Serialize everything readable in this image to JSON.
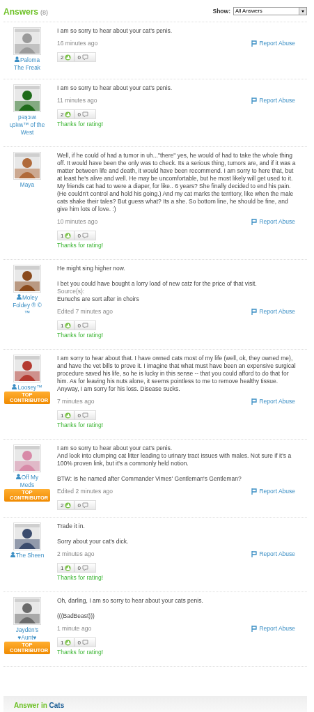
{
  "header": {
    "title": "Answers",
    "count": "(8)",
    "filter_label": "Show:",
    "filter_value": "All Answers"
  },
  "answers": [
    {
      "author": {
        "name": "Paloma The Freak",
        "user_icon": true
      },
      "avatar": {
        "kind": "picture"
      },
      "paragraphs": [
        "I am so sorry to hear about your cat's penis."
      ],
      "time": "16 minutes ago",
      "report": "Report Abuse",
      "up": "2",
      "down": "0"
    },
    {
      "author": {
        "name": "pǝʞɔıʍ ɥɔʇıʍ™ of the West",
        "user_icon": false
      },
      "avatar": {
        "kind": "picture"
      },
      "paragraphs": [
        "I am so sorry to hear about your cat's penis."
      ],
      "time": "11 minutes ago",
      "report": "Report Abuse",
      "up": "2",
      "down": "0",
      "thanks": "Thanks for rating!"
    },
    {
      "author": {
        "name": "Maya",
        "user_icon": false
      },
      "avatar": {
        "kind": "picture"
      },
      "paragraphs": [
        "Well, if he could of had a tumor in uh...\"there\" yes, he would of had to take the whole thing off. It would have been the only was to check. Its a serious thing, tumors are, and if it was a matter between life and death, it would have been recommend. I am sorry to here that, but at least he's alive and well. He may be uncomfortable, but he most likely will get used to it. My friends cat had to were a diaper, for like.. 6 years? She finally decided to end his pain. (He couldn't control and hold his going.) And my cat marks the territory, like when the male cats shake their tales? But guess what? Its a she. So bottom line, he should be fine, and give him lots of love. :)"
      ],
      "time": "10 minutes ago",
      "report": "Report Abuse",
      "up": "1",
      "down": "0",
      "thanks": "Thanks for rating!"
    },
    {
      "author": {
        "name": "Moley Foldey ® © ™",
        "user_icon": true
      },
      "avatar": {
        "kind": "picture"
      },
      "paragraphs": [
        "He might sing higher now.",
        "I bet you could have bought a lorry load of new catz for the price of that visit."
      ],
      "source": {
        "label": "Source(s):",
        "text": "Eunuchs are sort after in choirs"
      },
      "time": "Edited 7 minutes ago",
      "report": "Report Abuse",
      "up": "1",
      "down": "0",
      "thanks": "Thanks for rating!"
    },
    {
      "author": {
        "name": "Loosey™",
        "user_icon": true,
        "badge": "TOP CONTRIBUTOR"
      },
      "avatar": {
        "kind": "picture"
      },
      "paragraphs": [
        "I am sorry to hear about that. I have owned cats most of my life (well, ok, they owned me), and have the vet bills to prove it. I imagine that what must have been an expensive surgical procedure saved his life, so he is lucky in this sense -- that you could afford to do that for him. As for leaving his nuts alone, it seems pointless to me to remove healthy tissue. Anyway, I am sorry for his loss. Disease sucks."
      ],
      "time": "7 minutes ago",
      "report": "Report Abuse",
      "up": "1",
      "down": "0",
      "thanks": "Thanks for rating!"
    },
    {
      "author": {
        "name": "Off My Meds",
        "user_icon": true,
        "badge": "TOP CONTRIBUTOR"
      },
      "avatar": {
        "kind": "picture"
      },
      "paragraphs": [
        "I am so sorry to hear about your cat's penis.\nAnd look into clumping cat litter leading to urinary tract issues with males. Not sure if it's a 100% proven link, but it's a commonly held notion.",
        "BTW: Is he named after Commander Vimes' Gentleman's Gentleman?"
      ],
      "time": "Edited 2 minutes ago",
      "report": "Report Abuse",
      "up": "2",
      "down": "0"
    },
    {
      "author": {
        "name": "The Sheen",
        "user_icon": true
      },
      "avatar": {
        "kind": "picture"
      },
      "paragraphs": [
        "Trade it in.",
        "Sorry about your cat's dick."
      ],
      "time": "2 minutes ago",
      "report": "Report Abuse",
      "up": "1",
      "down": "0",
      "thanks": "Thanks for rating!"
    },
    {
      "author": {
        "name": "Jaydën's ♥Aunt♥",
        "user_icon": false,
        "badge": "TOP CONTRIBUTOR"
      },
      "avatar": {
        "kind": "picture"
      },
      "paragraphs": [
        "Oh, darling, I am so sorry to hear about your cats penis.",
        "(((BadBeast)))"
      ],
      "time": "1 minute ago",
      "report": "Report Abuse",
      "up": "1",
      "down": "0",
      "thanks": "Thanks for rating!"
    }
  ],
  "footer": {
    "prefix": "Answer in",
    "category": "Cats"
  }
}
